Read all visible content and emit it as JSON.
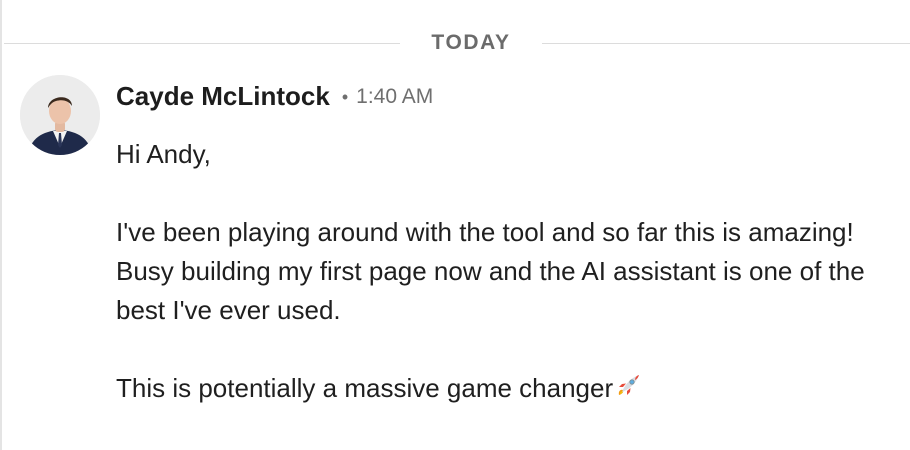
{
  "divider": {
    "label": "TODAY"
  },
  "message": {
    "author": {
      "name": "Cayde McLintock",
      "avatar": "avatar-photo"
    },
    "separator": "•",
    "timestamp": "1:40 AM",
    "greeting": "Hi Andy,",
    "paragraph_1": "I've been playing around with the tool and so far this is amazing! Busy building my first page now and the AI assistant is one of the best I've ever used.",
    "paragraph_2": "This is potentially a massive game changer",
    "emoji": "rocket-icon"
  },
  "colors": {
    "divider_text": "#6b6b6b",
    "divider_line": "#dcdcdc",
    "meta_text": "#6f6f6f",
    "body_text": "#1f1f1f"
  }
}
